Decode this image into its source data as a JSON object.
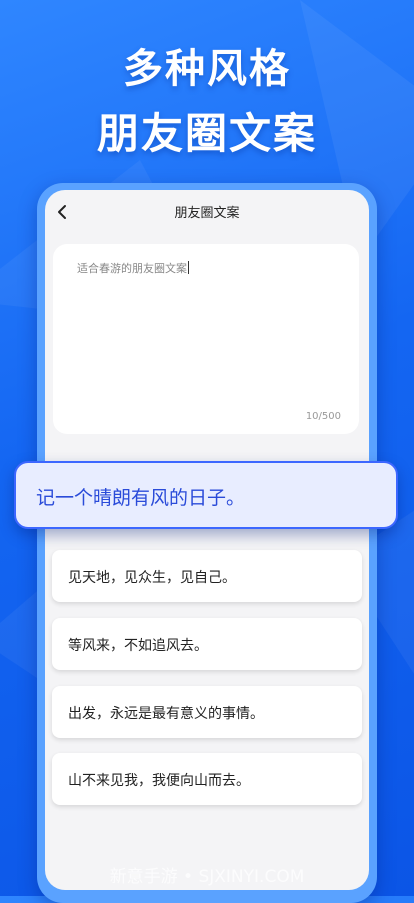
{
  "promo": {
    "line1": "多种风格",
    "line2": "朋友圈文案"
  },
  "app": {
    "title": "朋友圈文案",
    "input_value": "适合春游的朋友圈文案",
    "char_count": "10/500"
  },
  "highlight": "记一个晴朗有风的日子。",
  "results": [
    "见天地，见众生，见自己。",
    "等风来，不如追风去。",
    "出发，永远是最有意义的事情。",
    "山不来见我，我便向山而去。"
  ],
  "watermark": "新意手游 • SJXINYI.COM",
  "colors": {
    "background": "#1466f2",
    "frame": "#5aa2ff",
    "highlight_border": "#3c67ff",
    "highlight_text": "#2a4bd9"
  },
  "icons": {
    "back": "chevron-left-icon"
  }
}
